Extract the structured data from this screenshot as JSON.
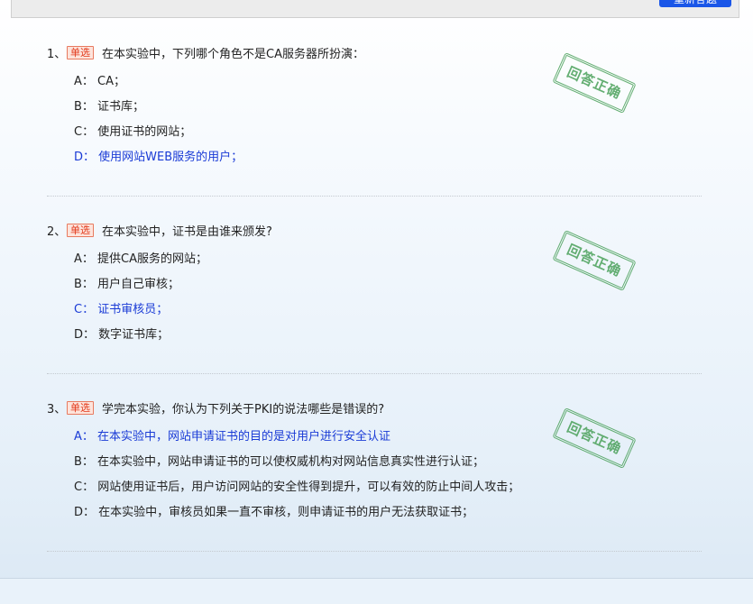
{
  "top_button": {
    "label": "重新答题"
  },
  "questions": [
    {
      "number": "1、",
      "type": "单选",
      "text": "在本实验中，下列哪个角色不是CA服务器所扮演：",
      "stamp": "回答正确",
      "options": [
        {
          "text": "A：  CA；"
        },
        {
          "text": "B：  证书库；"
        },
        {
          "text": "C：  使用证书的网站；"
        },
        {
          "text": "D：  使用网站WEB服务的用户；"
        }
      ]
    },
    {
      "number": "2、",
      "type": "单选",
      "text": "在本实验中，证书是由谁来颁发?",
      "stamp": "回答正确",
      "options": [
        {
          "text": "A：  提供CA服务的网站；"
        },
        {
          "text": "B：  用户自己审核；"
        },
        {
          "text": "C：  证书审核员；"
        },
        {
          "text": "D：  数字证书库；"
        }
      ]
    },
    {
      "number": "3、",
      "type": "单选",
      "text": "学完本实验，你认为下列关于PKI的说法哪些是错误的?",
      "stamp": "回答正确",
      "options": [
        {
          "text": "A：  在本实验中，网站申请证书的目的是对用户进行安全认证"
        },
        {
          "text": "B：  在本实验中，网站申请证书的可以使权威机构对网站信息真实性进行认证；"
        },
        {
          "text": "C：  网站使用证书后，用户访问网站的安全性得到提升，可以有效的防止中间人攻击；"
        },
        {
          "text": "D：  在本实验中，审核员如果一直不审核，则申请证书的用户无法获取证书；"
        }
      ]
    }
  ]
}
